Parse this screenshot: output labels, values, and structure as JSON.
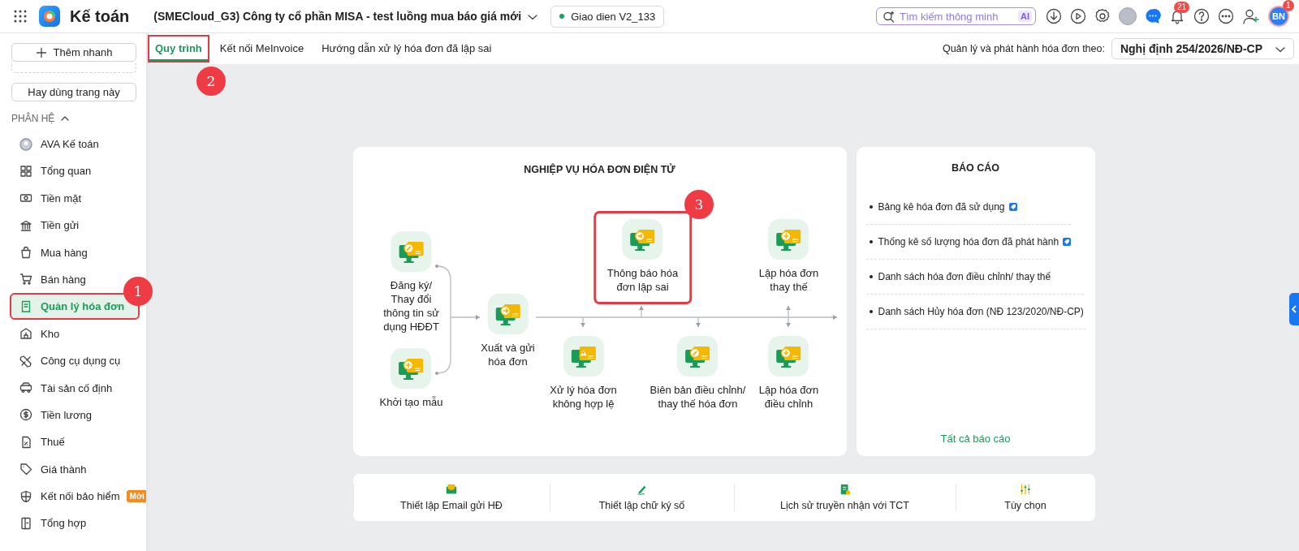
{
  "app": {
    "title": "Kế toán",
    "company": "(SMECloud_G3) Công ty cổ phần MISA - test luồng mua báo giá mới",
    "version": "Giao dien V2_133",
    "search_placeholder": "Tìm kiếm thông minh",
    "search_badge": "AI",
    "notification_count": "21",
    "avatar_initials": "BN",
    "avatar_badge": "1"
  },
  "sidebar": {
    "quick_add": "Thêm nhanh",
    "favorite_button": "Hay dùng trang này",
    "section": "PHÂN HỆ",
    "section_expanded": true,
    "items": [
      {
        "label": "AVA Kế toán",
        "selected": false,
        "outlined": false
      },
      {
        "label": "Tổng quan",
        "selected": false,
        "outlined": false
      },
      {
        "label": "Tiền mặt",
        "selected": false,
        "outlined": false
      },
      {
        "label": "Tiền gửi",
        "selected": false,
        "outlined": false
      },
      {
        "label": "Mua hàng",
        "selected": false,
        "outlined": false
      },
      {
        "label": "Bán hàng",
        "selected": false,
        "outlined": false
      },
      {
        "label": "Quản lý hóa đơn",
        "selected": true,
        "outlined": true
      },
      {
        "label": "Kho",
        "selected": false,
        "outlined": false
      },
      {
        "label": "Công cụ dụng cụ",
        "selected": false,
        "outlined": false
      },
      {
        "label": "Tài sản cố định",
        "selected": false,
        "outlined": false
      },
      {
        "label": "Tiền lương",
        "selected": false,
        "outlined": false
      },
      {
        "label": "Thuế",
        "selected": false,
        "outlined": false
      },
      {
        "label": "Giá thành",
        "selected": false,
        "outlined": false
      },
      {
        "label": "Kết nối bảo hiểm",
        "selected": false,
        "outlined": false,
        "badge": "Mới"
      },
      {
        "label": "Tổng hợp",
        "selected": false,
        "outlined": false
      }
    ]
  },
  "tabs": [
    {
      "label": "Quy trình",
      "selected": true,
      "outlined": true
    },
    {
      "label": "Kết nối MeInvoice",
      "selected": false,
      "outlined": false
    },
    {
      "label": "Hướng dẫn xử lý hóa đơn đã lập sai",
      "selected": false,
      "outlined": false
    }
  ],
  "regulation": {
    "label": "Quản lý và phát hành hóa đơn theo:",
    "value": "Nghị định 254/2026/NĐ-CP"
  },
  "process_card": {
    "title": "NGHIỆP VỤ HÓA ĐƠN ĐIỆN TỬ",
    "nodes": [
      {
        "label": "Đăng ký/\nThay đổi\nthông tin sử\ndụng HĐĐT",
        "outlined": false
      },
      {
        "label": "Khởi tạo mẫu",
        "outlined": false
      },
      {
        "label": "Xuất và gửi\nhóa đơn",
        "outlined": false
      },
      {
        "label": "Thông báo hóa\nđơn lập sai",
        "outlined": true
      },
      {
        "label": "Lập hóa đơn\nthay thế",
        "outlined": false
      },
      {
        "label": "Xử lý hóa đơn\nkhông hợp lệ",
        "outlined": false
      },
      {
        "label": "Biên bản điều chỉnh/\nthay thế hóa đơn",
        "outlined": false
      },
      {
        "label": "Lập hóa đơn\nđiều chỉnh",
        "outlined": false
      }
    ]
  },
  "report_card": {
    "title": "BÁO CÁO",
    "items": [
      {
        "label": "Bảng kê hóa đơn đã sử dụng",
        "tagged": true
      },
      {
        "label": "Thống kê số lượng hóa đơn đã phát hành",
        "tagged": true
      },
      {
        "label": "Danh sách hóa đơn điều chỉnh/ thay thế",
        "tagged": false
      },
      {
        "label": "Danh sách Hủy hóa đơn (NĐ 123/2020/NĐ-CP)",
        "tagged": false
      }
    ],
    "footer_link": "Tất cả báo cáo"
  },
  "shortcuts": [
    {
      "label": "Thiết lập Email gửi HĐ"
    },
    {
      "label": "Thiết lập chữ ký số"
    },
    {
      "label": "Lịch sử truyền nhận với TCT"
    },
    {
      "label": "Tùy chọn"
    }
  ],
  "annotations": [
    {
      "label": "1"
    },
    {
      "label": "2"
    },
    {
      "label": "3"
    }
  ]
}
